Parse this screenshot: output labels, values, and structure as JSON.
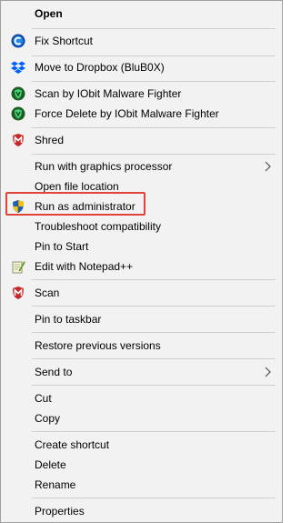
{
  "menu": {
    "items": [
      {
        "label": "Open",
        "icon": "none"
      },
      {
        "label": "Fix Shortcut",
        "icon": "fix-shortcut-icon"
      },
      {
        "label": "Move to Dropbox (BluB0X)",
        "icon": "dropbox-icon"
      },
      {
        "label": "Scan by IObit Malware Fighter",
        "icon": "iobit-shield-icon"
      },
      {
        "label": "Force Delete by IObit Malware Fighter",
        "icon": "iobit-shield-icon"
      },
      {
        "label": "Shred",
        "icon": "mcafee-icon"
      },
      {
        "label": "Run with graphics processor",
        "icon": "none",
        "submenu": true
      },
      {
        "label": "Open file location",
        "icon": "none"
      },
      {
        "label": "Run as administrator",
        "icon": "uac-shield-icon",
        "highlighted": true
      },
      {
        "label": "Troubleshoot compatibility",
        "icon": "none"
      },
      {
        "label": "Pin to Start",
        "icon": "none"
      },
      {
        "label": "Edit with Notepad++",
        "icon": "notepadpp-icon"
      },
      {
        "label": "Scan",
        "icon": "mcafee-icon"
      },
      {
        "label": "Pin to taskbar",
        "icon": "none"
      },
      {
        "label": "Restore previous versions",
        "icon": "none"
      },
      {
        "label": "Send to",
        "icon": "none",
        "submenu": true
      },
      {
        "label": "Cut",
        "icon": "none"
      },
      {
        "label": "Copy",
        "icon": "none"
      },
      {
        "label": "Create shortcut",
        "icon": "none"
      },
      {
        "label": "Delete",
        "icon": "none"
      },
      {
        "label": "Rename",
        "icon": "none"
      },
      {
        "label": "Properties",
        "icon": "none"
      }
    ]
  },
  "colors": {
    "menu_background": "#f2f2f2",
    "highlight_border": "#e0453a",
    "dropbox_blue": "#0061fe",
    "iobit_green": "#1f8a3e",
    "mcafee_red": "#c01818",
    "fix_shortcut_blue": "#1565c0"
  }
}
